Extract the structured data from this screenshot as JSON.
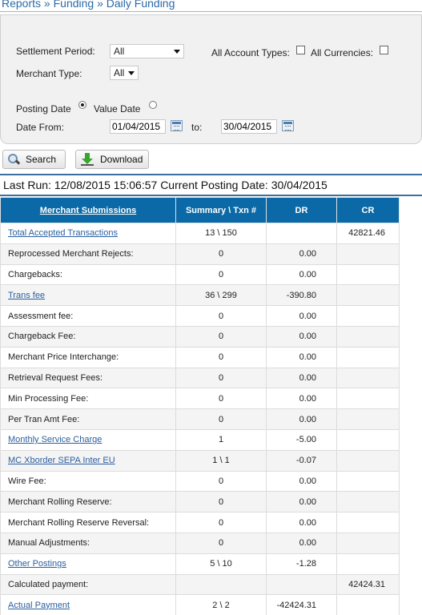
{
  "breadcrumb": {
    "items": [
      "Reports",
      "Funding",
      "Daily Funding"
    ],
    "separator": "»"
  },
  "filters": {
    "settlement_period_label": "Settlement Period:",
    "settlement_period_value": "All",
    "all_account_types_label": "All Account Types:",
    "all_account_types_checked": false,
    "all_currencies_label": "All Currencies:",
    "all_currencies_checked": false,
    "merchant_type_label": "Merchant Type:",
    "merchant_type_value": "All",
    "posting_date_label": "Posting Date",
    "value_date_label": "Value Date",
    "selected_date_mode": "posting",
    "date_from_label": "Date From:",
    "date_from_value": "01/04/2015",
    "date_to_label": "to:",
    "date_to_value": "30/04/2015"
  },
  "actions": {
    "search_label": "Search",
    "download_label": "Download"
  },
  "status": {
    "last_run_label": "Last Run:",
    "last_run_value": "12/08/2015 15:06:57",
    "current_posting_label": "Current Posting Date:",
    "current_posting_value": "30/04/2015"
  },
  "table": {
    "headers": [
      "Merchant Submissions",
      "Summary \\ Txn #",
      "DR",
      "CR"
    ],
    "rows": [
      {
        "name": "Total Accepted Transactions",
        "link": true,
        "summary": "13 \\ 150",
        "dr": "",
        "cr": "42821.46"
      },
      {
        "name": "Reprocessed Merchant Rejects:",
        "link": false,
        "summary": "0",
        "dr": "0.00",
        "cr": ""
      },
      {
        "name": "Chargebacks:",
        "link": false,
        "summary": "0",
        "dr": "0.00",
        "cr": ""
      },
      {
        "name": "Trans fee",
        "link": true,
        "summary": "36 \\ 299",
        "dr": "-390.80",
        "cr": ""
      },
      {
        "name": "Assessment fee:",
        "link": false,
        "summary": "0",
        "dr": "0.00",
        "cr": ""
      },
      {
        "name": "Chargeback Fee:",
        "link": false,
        "summary": "0",
        "dr": "0.00",
        "cr": ""
      },
      {
        "name": "Merchant Price Interchange:",
        "link": false,
        "summary": "0",
        "dr": "0.00",
        "cr": ""
      },
      {
        "name": "Retrieval Request Fees:",
        "link": false,
        "summary": "0",
        "dr": "0.00",
        "cr": ""
      },
      {
        "name": "Min Processing Fee:",
        "link": false,
        "summary": "0",
        "dr": "0.00",
        "cr": ""
      },
      {
        "name": "Per Tran Amt Fee:",
        "link": false,
        "summary": "0",
        "dr": "0.00",
        "cr": ""
      },
      {
        "name": "Monthly Service Charge",
        "link": true,
        "summary": "1",
        "dr": "-5.00",
        "cr": ""
      },
      {
        "name": "MC Xborder SEPA Inter EU",
        "link": true,
        "summary": "1 \\ 1",
        "dr": "-0.07",
        "cr": ""
      },
      {
        "name": "Wire Fee:",
        "link": false,
        "summary": "0",
        "dr": "0.00",
        "cr": ""
      },
      {
        "name": "Merchant Rolling Reserve:",
        "link": false,
        "summary": "0",
        "dr": "0.00",
        "cr": ""
      },
      {
        "name": "Merchant Rolling Reserve Reversal:",
        "link": false,
        "summary": "0",
        "dr": "0.00",
        "cr": ""
      },
      {
        "name": "Manual Adjustments:",
        "link": false,
        "summary": "0",
        "dr": "0.00",
        "cr": ""
      },
      {
        "name": "Other Postings",
        "link": true,
        "summary": "5 \\ 10",
        "dr": "-1.28",
        "cr": ""
      },
      {
        "name": "Calculated payment:",
        "link": false,
        "summary": "",
        "dr": "",
        "cr": "42424.31"
      },
      {
        "name": "Actual Payment",
        "link": true,
        "summary": "2 \\ 2",
        "dr": "-42424.31",
        "cr": ""
      }
    ]
  }
}
